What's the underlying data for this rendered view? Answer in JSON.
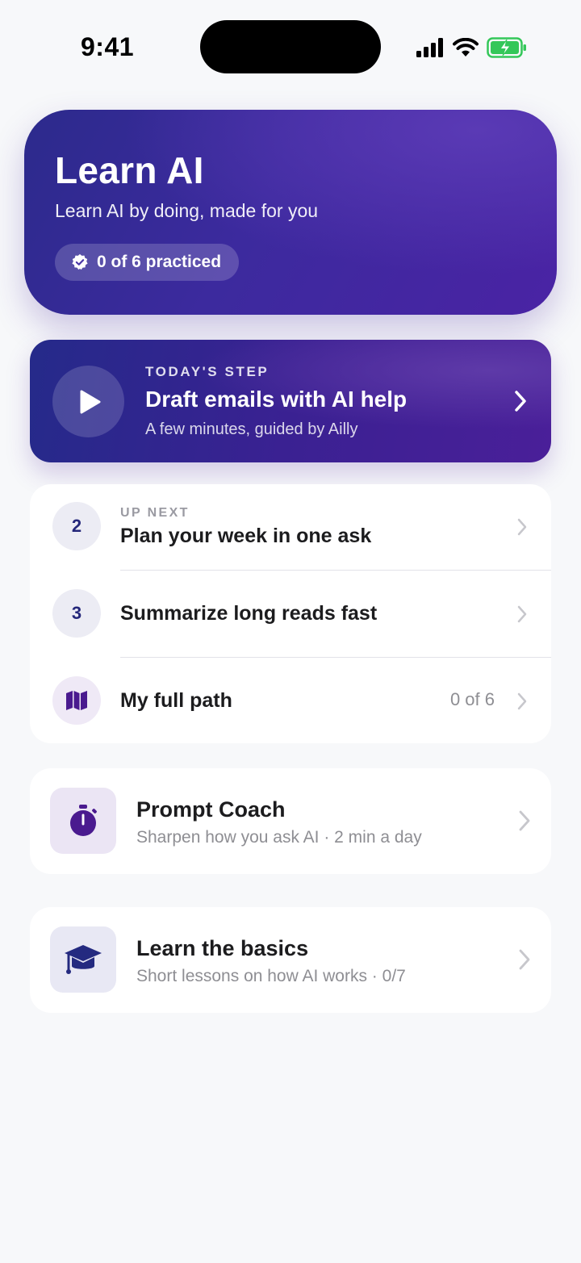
{
  "status_bar": {
    "time": "9:41",
    "battery_color": "#34c759"
  },
  "hero": {
    "title": "Learn AI",
    "subtitle": "Learn AI by doing, made for you",
    "progress_label": "0 of 6 practiced",
    "badge_icon": "verified-badge-icon"
  },
  "todays_step": {
    "kicker": "TODAY'S STEP",
    "title": "Draft emails with AI help",
    "subtitle": "A few minutes, guided by Ailly",
    "icon": "play-icon"
  },
  "path": {
    "items": [
      {
        "number": "2",
        "kicker": "UP NEXT",
        "title": "Plan your week in one ask"
      },
      {
        "number": "3",
        "title": "Summarize long reads fast"
      },
      {
        "icon": "map-icon",
        "title": "My full path",
        "meta": "0 of 6"
      }
    ]
  },
  "features": [
    {
      "title": "Prompt Coach",
      "subtitle": "Sharpen how you ask AI · 2 min a day",
      "icon": "stopwatch-icon",
      "icon_bg": "#ebe5f4",
      "icon_color": "#4a1a8f"
    },
    {
      "title": "Learn the basics",
      "subtitle": "Short lessons on how AI works · 0/7",
      "icon": "graduation-cap-icon",
      "icon_bg": "#e8e8f4",
      "icon_color": "#242a80"
    }
  ],
  "colors": {
    "accent": "#3a2496",
    "background": "#f7f8fa"
  }
}
